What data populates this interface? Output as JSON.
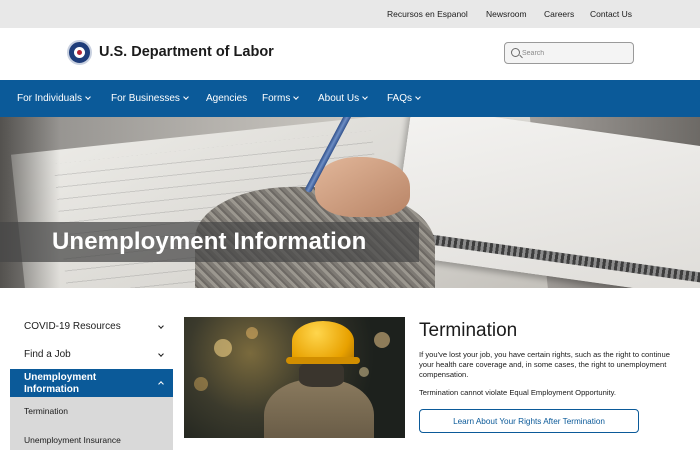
{
  "utility_nav": {
    "links": [
      "Recursos en Espanol",
      "Newsroom",
      "Careers",
      "Contact Us"
    ]
  },
  "header": {
    "site_name": "U.S. Department of Labor",
    "search": {
      "placeholder": "Search",
      "value": ""
    }
  },
  "main_nav": {
    "items": [
      {
        "label": "For Individuals",
        "has_dropdown": true
      },
      {
        "label": "For Businesses",
        "has_dropdown": true
      },
      {
        "label": "Agencies",
        "has_dropdown": false
      },
      {
        "label": "Forms",
        "has_dropdown": true
      },
      {
        "label": "About Us",
        "has_dropdown": true
      },
      {
        "label": "FAQs",
        "has_dropdown": true
      }
    ]
  },
  "hero": {
    "title": "Unemployment Information"
  },
  "sidebar": {
    "items": [
      {
        "label": "COVID-19 Resources",
        "expanded": false
      },
      {
        "label": "Find a Job",
        "expanded": false
      }
    ],
    "active": {
      "label": "Unemployment Information",
      "expanded": true
    },
    "sub_items": [
      "Termination",
      "Unemployment Insurance"
    ]
  },
  "feature": {
    "title": "Termination",
    "description": "If you've lost your job, you have certain rights, such as the right to continue your health care coverage and, in some cases, the right to unemployment compensation.",
    "note": "Termination cannot violate Equal Employment Opportunity.",
    "button_label": "Learn About Your Rights After Termination"
  },
  "colors": {
    "brand_blue": "#0b5a99",
    "utility_bar_bg": "#e8e8e8",
    "submenu_bg": "#d9d9d9"
  }
}
